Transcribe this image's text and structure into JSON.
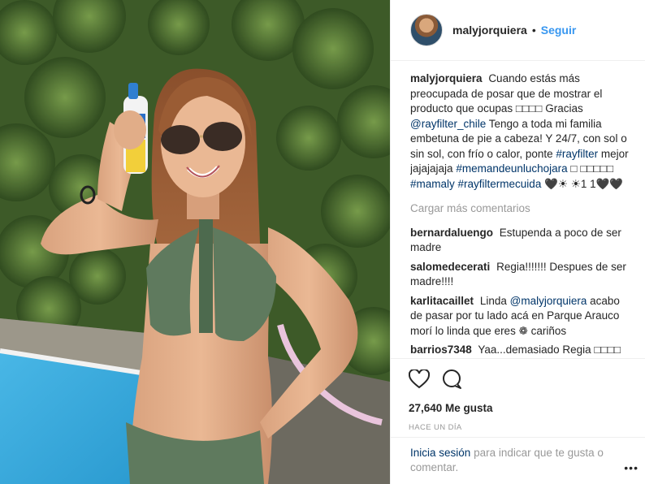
{
  "header": {
    "username": "malyjorquiera",
    "separator": "•",
    "follow_label": "Seguir"
  },
  "caption": {
    "username": "malyjorquiera",
    "text_1": "Cuando estás más preocupada de posar que de mostrar el producto que ocupas □□□□ Gracias",
    "mention": "@rayfilter_chile",
    "text_2": "Tengo a toda mi familia embetuna de pie a cabeza! Y 24/7, con sol o sin sol, con frío o calor, ponte",
    "tag_1": "#rayfilter",
    "text_3": "mejor jajajajaja",
    "tag_2": "#memandeunluchojara",
    "text_4": "□ □□□□□",
    "tag_3": "#mamaly",
    "tag_4": "#rayfiltermecuida",
    "text_5": "🖤☀ ☀1 1🖤🖤"
  },
  "load_more_label": "Cargar más comentarios",
  "comments": [
    {
      "user": "bernardaluengo",
      "text": "Estupenda a poco de ser madre"
    },
    {
      "user": "salomedecerati",
      "text": "Regia!!!!!!! Despues de ser madre!!!!"
    },
    {
      "user": "karlitacaillet",
      "text_1": "Linda",
      "mention": "@malyjorquiera",
      "text_2": "acabo de pasar por tu lado acá en Parque Arauco morí lo linda que eres ❁ cariños"
    },
    {
      "user": "barrios7348",
      "text": "Yaa...demasiado Regia □□□□"
    }
  ],
  "likes_label": "27,640 Me gusta",
  "time_label": "HACE UN DÍA",
  "footer": {
    "login_label": "Inicia sesión",
    "rest": "para indicar que te gusta o comentar."
  },
  "more_label": "•••",
  "colors": {
    "link": "#3897f0",
    "tag": "#003569",
    "muted": "#999999",
    "text": "#262626"
  },
  "icons": [
    "heart-icon",
    "comment-icon",
    "more-options-icon"
  ]
}
